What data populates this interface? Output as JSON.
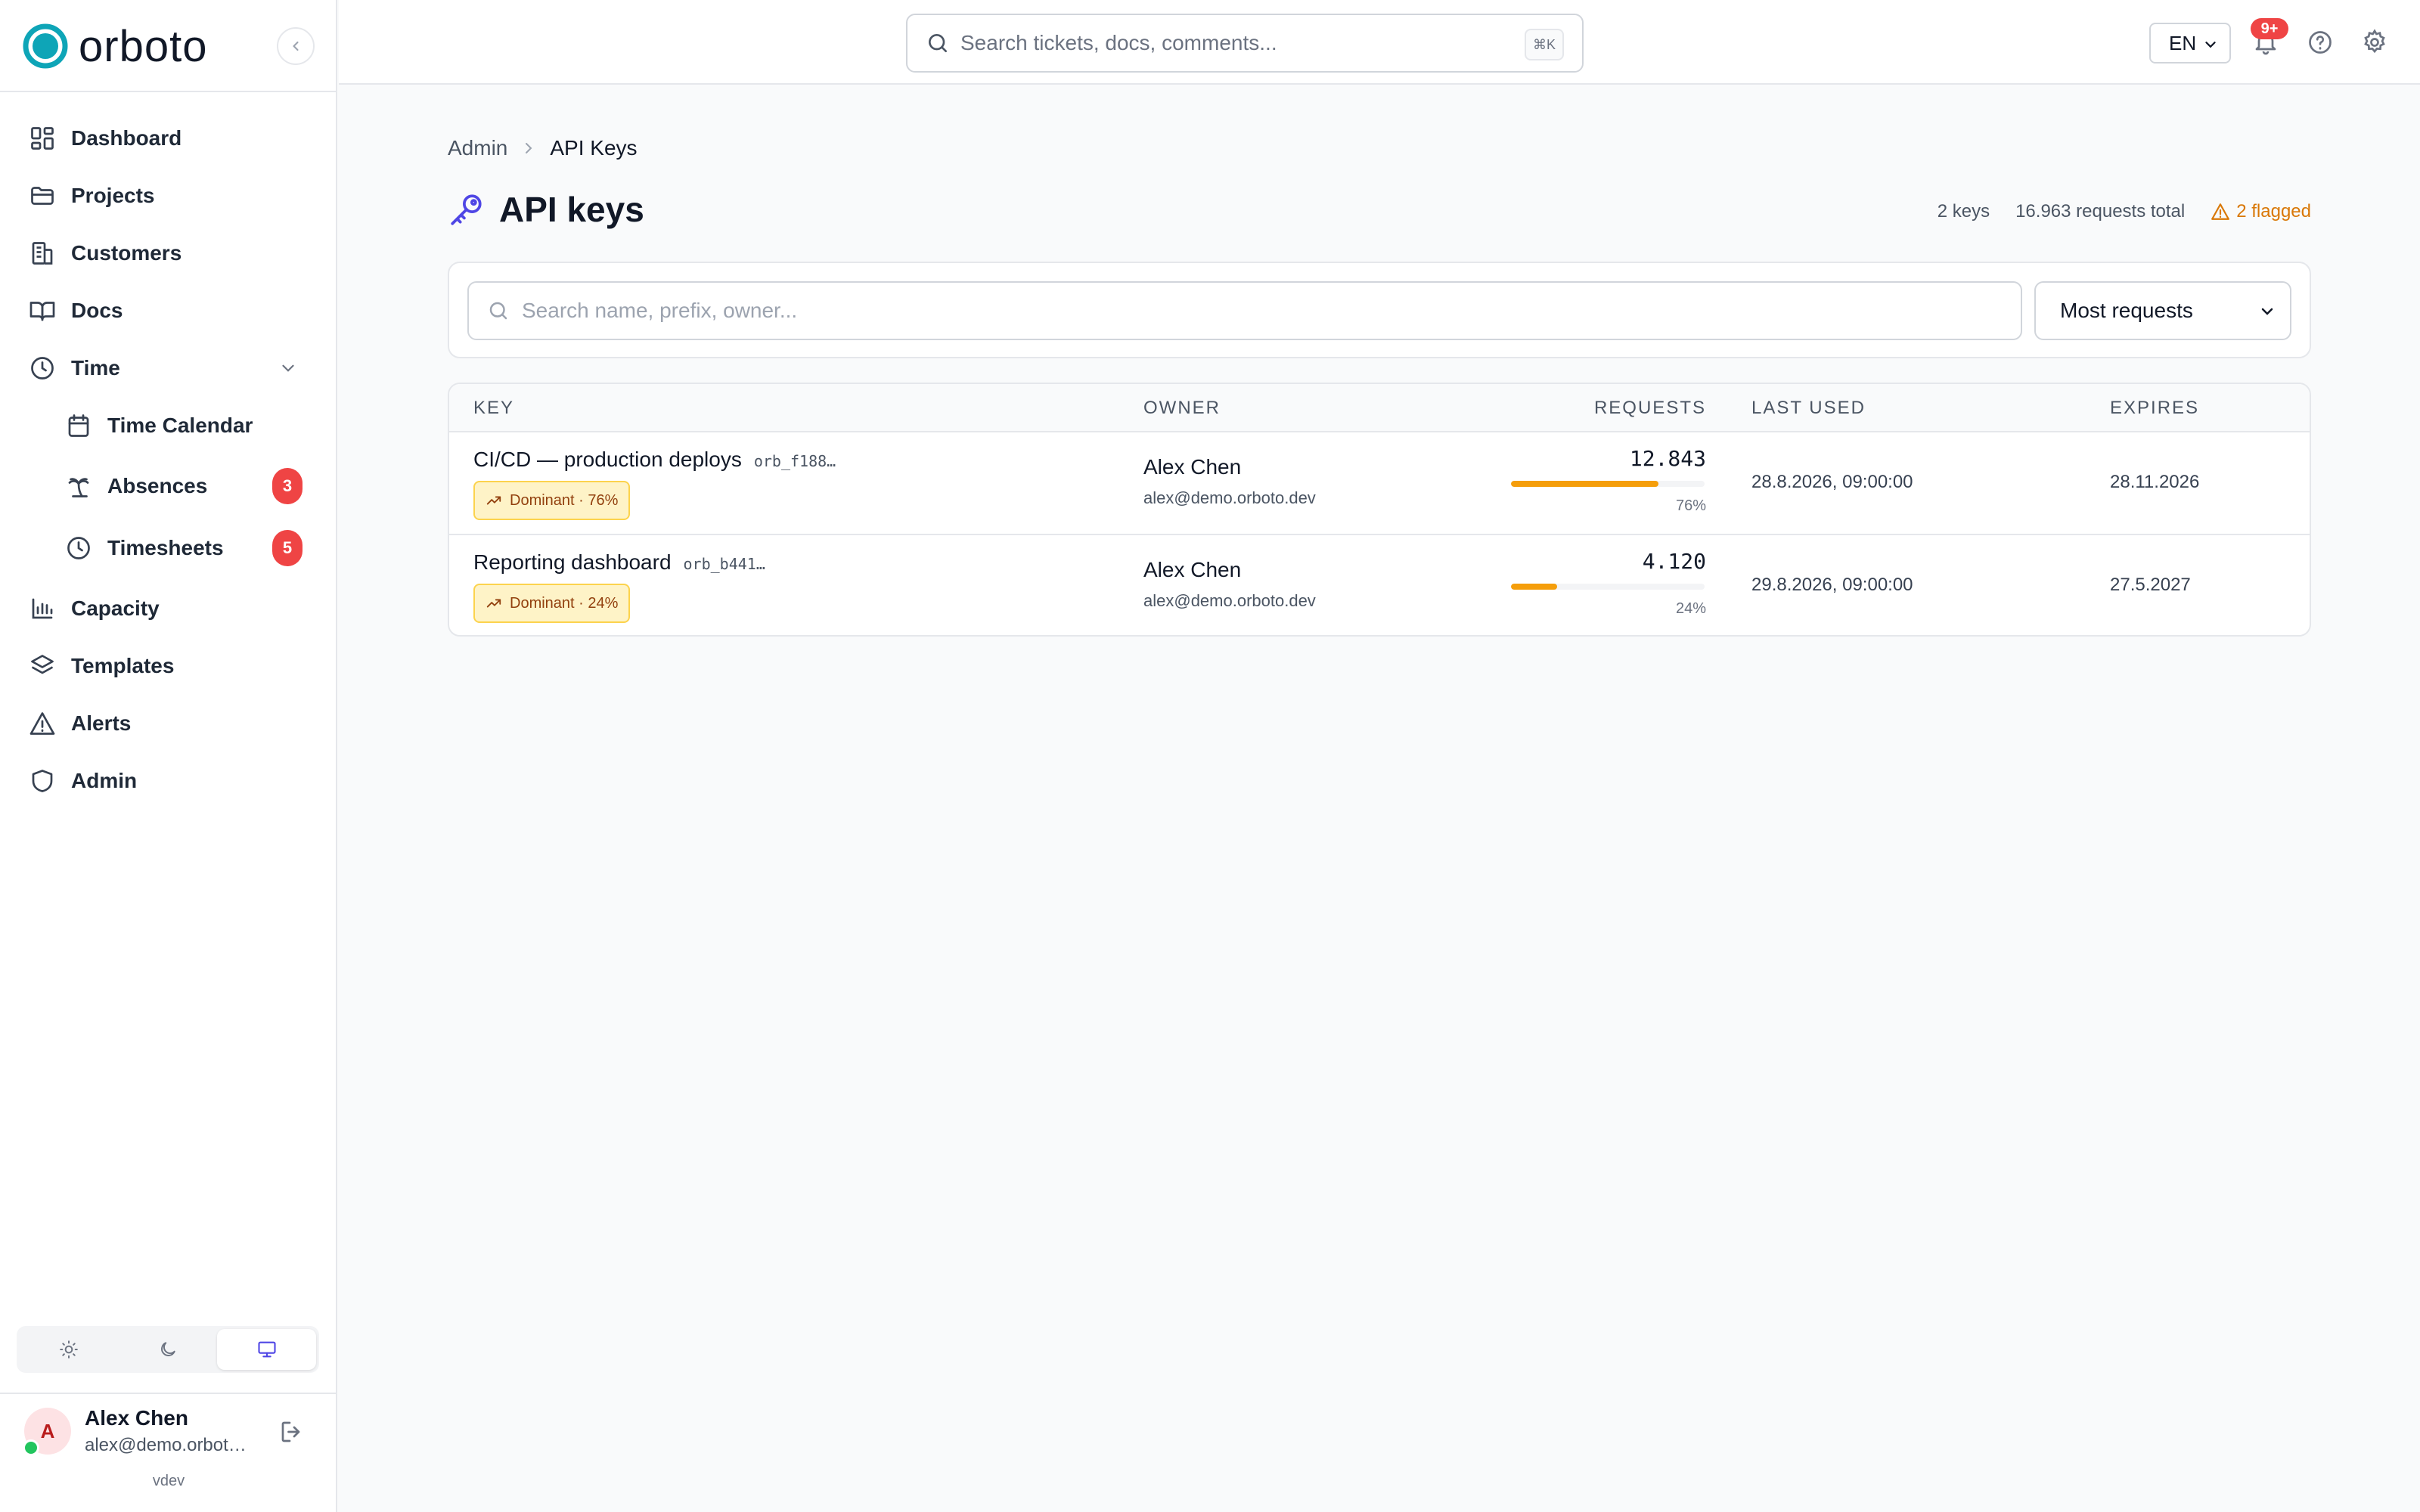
{
  "brand": {
    "name": "orboto",
    "accent": "#0ea5b7"
  },
  "sidebar": {
    "items": [
      {
        "label": "Dashboard",
        "icon": "dashboard-grid-icon"
      },
      {
        "label": "Projects",
        "icon": "folder-icon"
      },
      {
        "label": "Customers",
        "icon": "building-icon"
      },
      {
        "label": "Docs",
        "icon": "book-icon"
      },
      {
        "label": "Time",
        "icon": "clock-icon",
        "expanded": true
      },
      {
        "label": "Time Calendar",
        "icon": "calendar-icon"
      },
      {
        "label": "Absences",
        "icon": "palm-tree-icon",
        "badge": "3"
      },
      {
        "label": "Timesheets",
        "icon": "clock-icon",
        "badge": "5"
      },
      {
        "label": "Capacity",
        "icon": "bar-chart-icon"
      },
      {
        "label": "Templates",
        "icon": "layers-icon"
      },
      {
        "label": "Alerts",
        "icon": "warning-triangle-icon"
      },
      {
        "label": "Admin",
        "icon": "shield-icon"
      }
    ],
    "theme": {
      "options": [
        "light",
        "dark",
        "system"
      ],
      "selected": "system"
    },
    "user": {
      "initial": "A",
      "name": "Alex Chen",
      "email": "alex@demo.orbot…"
    },
    "version": "vdev"
  },
  "topbar": {
    "search_placeholder": "Search tickets, docs, comments...",
    "shortcut": "⌘K",
    "language": "EN",
    "notifications_badge": "9+"
  },
  "breadcrumb": {
    "parent": "Admin",
    "current": "API Keys"
  },
  "page": {
    "title": "API keys",
    "stats": {
      "keys": "2 keys",
      "requests": "16.963 requests total",
      "flagged": "2 flagged"
    }
  },
  "filters": {
    "search_placeholder": "Search name, prefix, owner...",
    "sort_selected": "Most requests"
  },
  "table": {
    "columns": [
      "Key",
      "Owner",
      "Requests",
      "Last used",
      "Expires"
    ],
    "rows": [
      {
        "name": "CI/CD — production deploys",
        "prefix": "orb_f188…",
        "badge": "Dominant · 76%",
        "owner": "Alex Chen",
        "owner_email": "alex@demo.orboto.dev",
        "requests": "12.843",
        "requests_share": 0.76,
        "requests_pct": "76%",
        "last_used": "28.8.2026, 09:00:00",
        "expires": "28.11.2026"
      },
      {
        "name": "Reporting dashboard",
        "prefix": "orb_b441…",
        "badge": "Dominant · 24%",
        "owner": "Alex Chen",
        "owner_email": "alex@demo.orboto.dev",
        "requests": "4.120",
        "requests_share": 0.24,
        "requests_pct": "24%",
        "last_used": "29.8.2026, 09:00:00",
        "expires": "27.5.2027"
      }
    ]
  }
}
